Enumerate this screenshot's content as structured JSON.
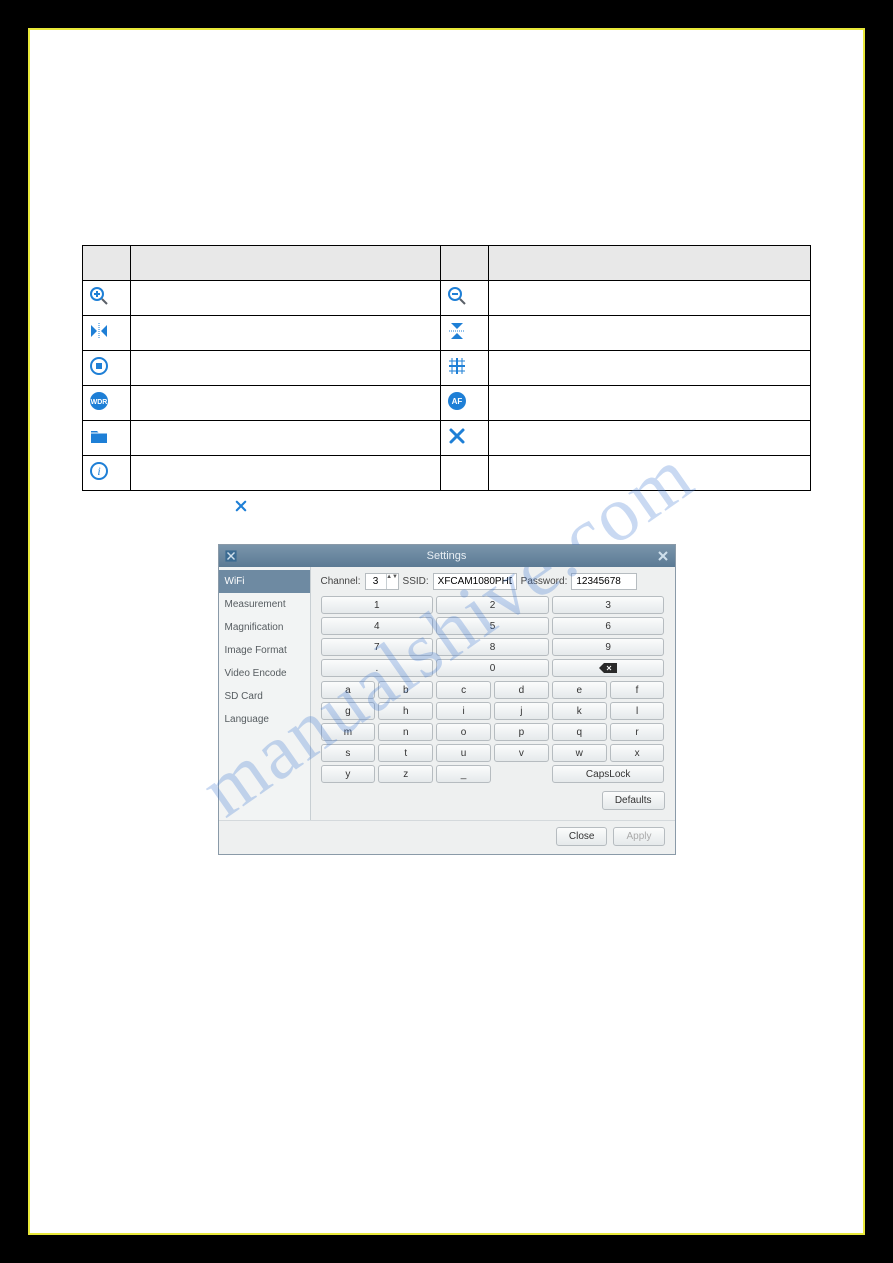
{
  "watermark": "manualshive.com",
  "table": {
    "headers": [
      "",
      "",
      "",
      ""
    ],
    "rows": [
      {
        "iconL": "zoom-in",
        "fnL": "",
        "iconR": "zoom-out",
        "fnR": ""
      },
      {
        "iconL": "flip-h",
        "fnL": "",
        "iconR": "flip-v",
        "fnR": ""
      },
      {
        "iconL": "freeze",
        "fnL": "",
        "iconR": "crosshair",
        "fnR": ""
      },
      {
        "iconL": "wdr",
        "fnL": "",
        "iconR": "af",
        "fnR": ""
      },
      {
        "iconL": "folder",
        "fnL": "",
        "iconR": "settings-x",
        "fnR": ""
      },
      {
        "iconL": "info",
        "fnL": "",
        "iconR": "",
        "fnR": ""
      }
    ]
  },
  "post_table_icon": "settings-x",
  "dialog": {
    "title": "Settings",
    "sidebar": [
      "WiFi",
      "Measurement",
      "Magnification",
      "Image Format",
      "Video Encode",
      "SD Card",
      "Language"
    ],
    "active_sidebar": 0,
    "channel_label": "Channel:",
    "channel_value": "3",
    "ssid_label": "SSID:",
    "ssid_value": "XFCAM1080PHD",
    "password_label": "Password:",
    "password_value": "12345678",
    "numpad": [
      "1",
      "2",
      "3",
      "4",
      "5",
      "6",
      "7",
      "8",
      "9",
      ".",
      "0",
      "⌫"
    ],
    "keyboard": [
      [
        "a",
        "b",
        "c",
        "d",
        "e",
        "f"
      ],
      [
        "g",
        "h",
        "i",
        "j",
        "k",
        "l"
      ],
      [
        "m",
        "n",
        "o",
        "p",
        "q",
        "r"
      ],
      [
        "s",
        "t",
        "u",
        "v",
        "w",
        "x"
      ]
    ],
    "bottom_row": {
      "y": "y",
      "z": "z",
      "underscore": "_",
      "capslock": "CapsLock"
    },
    "defaults_label": "Defaults",
    "close_label": "Close",
    "apply_label": "Apply"
  }
}
